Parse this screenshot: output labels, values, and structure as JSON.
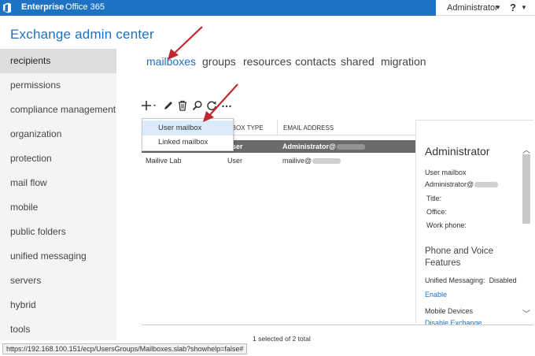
{
  "topbar": {
    "nav": [
      "Enterprise",
      "Office 365"
    ],
    "user": "Administrator",
    "help": "?"
  },
  "app_title": "Exchange admin center",
  "sidebar": {
    "items": [
      {
        "label": "recipients",
        "active": true
      },
      {
        "label": "permissions"
      },
      {
        "label": "compliance management"
      },
      {
        "label": "organization"
      },
      {
        "label": "protection"
      },
      {
        "label": "mail flow"
      },
      {
        "label": "mobile"
      },
      {
        "label": "public folders"
      },
      {
        "label": "unified messaging"
      },
      {
        "label": "servers"
      },
      {
        "label": "hybrid"
      },
      {
        "label": "tools"
      }
    ]
  },
  "tabs": [
    {
      "label": "mailboxes",
      "active": true
    },
    {
      "label": "groups"
    },
    {
      "label": "resources"
    },
    {
      "label": "contacts"
    },
    {
      "label": "shared"
    },
    {
      "label": "migration"
    }
  ],
  "toolbar": {
    "icons": [
      "add-icon",
      "edit-icon",
      "delete-icon",
      "search-icon",
      "refresh-icon",
      "more-icon"
    ]
  },
  "dropdown": {
    "items": [
      "User mailbox",
      "Linked mailbox"
    ]
  },
  "grid": {
    "columns": [
      "ILBOX TYPE",
      "EMAIL ADDRESS"
    ],
    "rows": [
      {
        "type": "ser",
        "email": "Administrator@",
        "selected": true
      },
      {
        "name": "Mailive Lab",
        "type": "User",
        "email": "mailive@"
      }
    ]
  },
  "detail": {
    "title": "Administrator",
    "mailbox_type": "User mailbox",
    "email": "Administrator@",
    "fields": [
      "Title:",
      "Office:",
      "Work phone:"
    ],
    "section_phone": "Phone and Voice Features",
    "um_label": "Unified Messaging:",
    "um_value": "Disabled",
    "enable_link": "Enable",
    "mobile_label": "Mobile Devices",
    "disable_link": "Disable Exchange"
  },
  "status": "1 selected of 2 total",
  "url": "https://192.168.100.151/ecp/UsersGroups/Mailboxes.slab?showhelp=false#",
  "colors": {
    "brand_blue": "#1d72c4",
    "link_blue": "#1f6fbf",
    "annotation_red": "#c0282d"
  }
}
